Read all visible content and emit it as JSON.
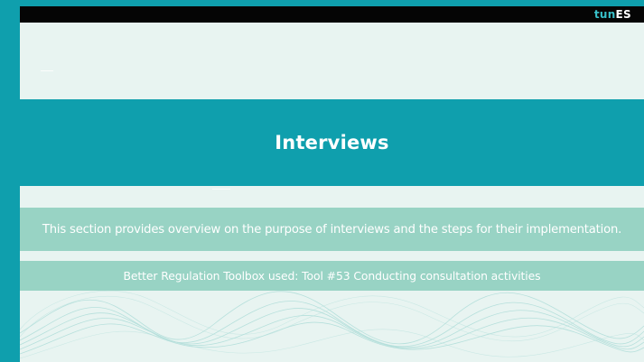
{
  "logo": {
    "prefix": "tun",
    "suffix": "ES"
  },
  "slide": {
    "title": "Interviews",
    "description": "This section provides overview on the purpose of interviews and the steps for their implementation.",
    "toolbox": "Better Regulation Toolbox used: Tool #53 Conducting consultation activities"
  },
  "colors": {
    "frame": "#0f9fad",
    "slide_bg": "#e8f4f1",
    "title_band": "#0f9fad",
    "info_band": "#98d3c4",
    "topbar": "#050505"
  }
}
